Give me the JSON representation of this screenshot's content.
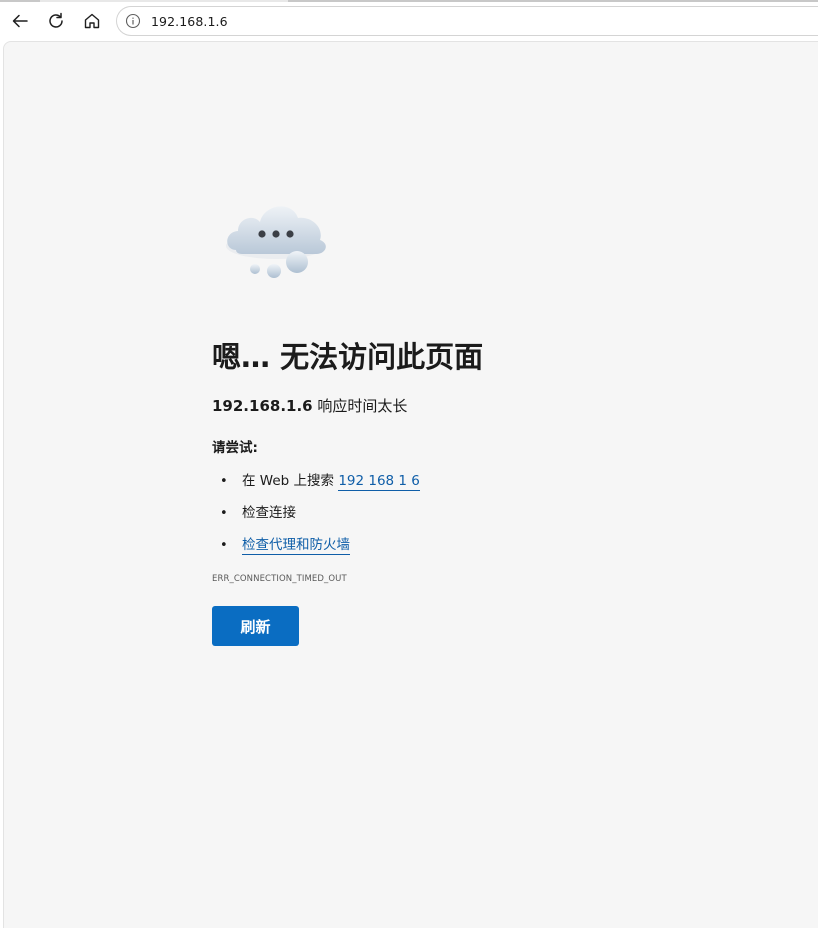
{
  "toolbar": {
    "back_icon": "back-arrow-icon",
    "reload_icon": "reload-icon",
    "home_icon": "home-icon",
    "site_info_icon": "info-icon",
    "url": "192.168.1.6"
  },
  "error_page": {
    "illustration": "cloud-icon",
    "title": "嗯… 无法访问此页面",
    "host": "192.168.1.6",
    "message": "响应时间太长",
    "try_label": "请尝试:",
    "suggestions": [
      {
        "prefix": "在 Web 上搜索 ",
        "link": "192 168 1 6"
      },
      {
        "text": "检查连接"
      },
      {
        "link": "检查代理和防火墙"
      }
    ],
    "error_code": "ERR_CONNECTION_TIMED_OUT",
    "refresh_label": "刷新"
  },
  "colors": {
    "page_background": "#f6f6f6",
    "link": "#0f5ea8",
    "primary_button": "#0a6dc2"
  }
}
